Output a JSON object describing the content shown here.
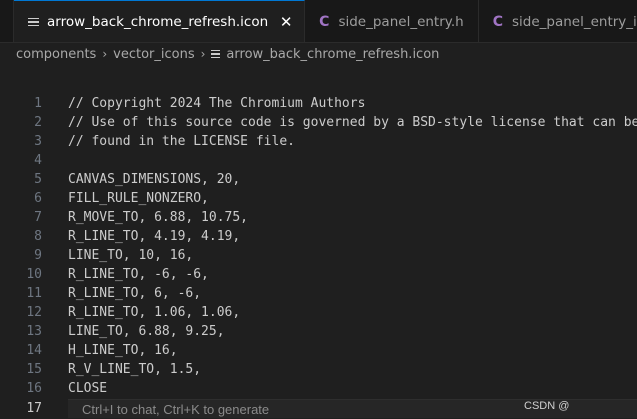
{
  "tabs": [
    {
      "label": "",
      "active": false,
      "icon": "none"
    },
    {
      "label": "arrow_back_chrome_refresh.icon",
      "active": true,
      "icon": "lines-icon"
    },
    {
      "label": "side_panel_entry.h",
      "active": false,
      "icon": "c-icon"
    },
    {
      "label": "side_panel_entry_id.h",
      "active": false,
      "icon": "c-icon"
    }
  ],
  "close_glyph": "✕",
  "c_glyph": "C",
  "breadcrumb": {
    "items": [
      "components",
      "vector_icons",
      "arrow_back_chrome_refresh.icon"
    ],
    "separator": "›"
  },
  "editor": {
    "lines": [
      {
        "num": "1",
        "text": "// Copyright 2024 The Chromium Authors"
      },
      {
        "num": "2",
        "text": "// Use of this source code is governed by a BSD-style license that can be"
      },
      {
        "num": "3",
        "text": "// found in the LICENSE file."
      },
      {
        "num": "4",
        "text": ""
      },
      {
        "num": "5",
        "text": "CANVAS_DIMENSIONS, 20,"
      },
      {
        "num": "6",
        "text": "FILL_RULE_NONZERO,"
      },
      {
        "num": "7",
        "text": "R_MOVE_TO, 6.88, 10.75,"
      },
      {
        "num": "8",
        "text": "R_LINE_TO, 4.19, 4.19,"
      },
      {
        "num": "9",
        "text": "LINE_TO, 10, 16,"
      },
      {
        "num": "10",
        "text": "R_LINE_TO, -6, -6,"
      },
      {
        "num": "11",
        "text": "R_LINE_TO, 6, -6,"
      },
      {
        "num": "12",
        "text": "R_LINE_TO, 1.06, 1.06,"
      },
      {
        "num": "13",
        "text": "LINE_TO, 6.88, 9.25,"
      },
      {
        "num": "14",
        "text": "H_LINE_TO, 16,"
      },
      {
        "num": "15",
        "text": "R_V_LINE_TO, 1.5,"
      },
      {
        "num": "16",
        "text": "CLOSE"
      }
    ],
    "current_line": {
      "num": "17",
      "hint": "Ctrl+I to chat, Ctrl+K to generate"
    }
  },
  "watermark": "CSDN @",
  "colors": {
    "background": "#1f1f1f",
    "tabbar": "#181818",
    "active_tab_accent": "#0078d4",
    "c_icon": "#a074c4",
    "line_number": "#6e7681",
    "text": "#cccccc"
  }
}
